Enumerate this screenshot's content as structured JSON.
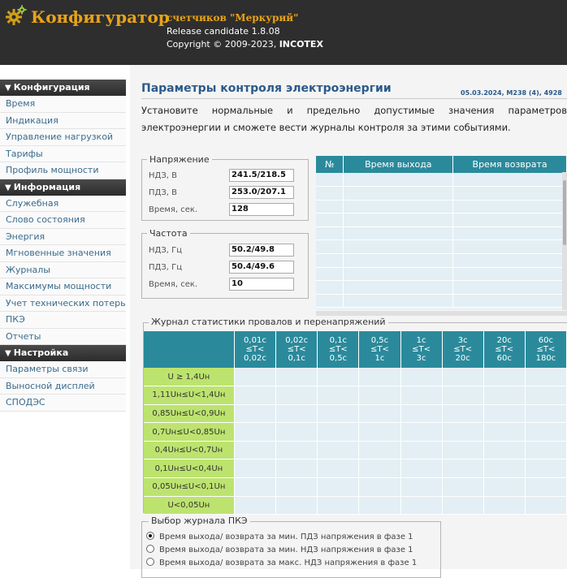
{
  "header": {
    "app_title": "Конфигуратор",
    "app_subtitle": "счетчиков \"Меркурий\"",
    "release": "Release candidate 1.8.08",
    "copyright_prefix": "Copyright © 2009-2023,",
    "copyright_company": "INCOTEX",
    "brand_color": "#e8a317"
  },
  "sidebar": {
    "sections": [
      {
        "title": "Конфигурация",
        "items": [
          "Время",
          "Индикация",
          "Управление нагрузкой",
          "Тарифы",
          "Профиль мощности"
        ]
      },
      {
        "title": "Информация",
        "items": [
          "Служебная",
          "Слово состояния",
          "Энергия",
          "Мгновенные значения",
          "Журналы",
          "Максимумы мощности",
          "Учет технических потерь",
          "ПКЭ",
          "Отчеты"
        ]
      },
      {
        "title": "Настройка",
        "items": [
          "Параметры связи",
          "Выносной дисплей",
          "СПОДЭС"
        ]
      }
    ]
  },
  "page": {
    "title": "Параметры контроля электроэнергии",
    "meta": "05.03.2024, M238 (4), 4928",
    "intro": "Установите нормальные и предельно допустимые значения параметров электроэнергии и сможете вести журналы контроля за этими событиями."
  },
  "voltage": {
    "legend": "Напряжение",
    "rows": [
      {
        "label": "НДЗ, В",
        "value": "241.5/218.5"
      },
      {
        "label": "ПДЗ, В",
        "value": "253.0/207.1"
      },
      {
        "label": "Время, сек.",
        "value": "128"
      }
    ]
  },
  "frequency": {
    "legend": "Частота",
    "rows": [
      {
        "label": "НДЗ, Гц",
        "value": "50.2/49.8"
      },
      {
        "label": "ПДЗ, Гц",
        "value": "50.4/49.6"
      },
      {
        "label": "Время, сек.",
        "value": "10"
      }
    ]
  },
  "events_table": {
    "headers": [
      "№",
      "Время выхода",
      "Время возврата"
    ]
  },
  "journal": {
    "legend": "Журнал статистики провалов и перенапряжений",
    "columns": [
      [
        "0,01с",
        "≤T<",
        "0,02с"
      ],
      [
        "0,02с",
        "≤T<",
        "0,1с"
      ],
      [
        "0,1с",
        "≤T<",
        "0,5с"
      ],
      [
        "0,5с",
        "≤T<",
        "1с"
      ],
      [
        "1с",
        "≤T<",
        "3с"
      ],
      [
        "3с",
        "≤T<",
        "20с"
      ],
      [
        "20с",
        "≤T<",
        "60с"
      ],
      [
        "60с",
        "≤T<",
        "180с"
      ]
    ],
    "rows": [
      "U ≥ 1,4Uн",
      "1,11Uн≤U<1,4Uн",
      "0,85Uн≤U<0,9Uн",
      "0,7Uн≤U<0,85Uн",
      "0,4Uн≤U<0,7Uн",
      "0,1Uн≤U<0,4Uн",
      "0,05Uн≤U<0,1Uн",
      "U<0,05Uн"
    ]
  },
  "pke": {
    "legend": "Выбор журнала ПКЭ",
    "options": [
      {
        "label": "Время выхода/ возврата за мин. ПДЗ напряжения в фазе 1",
        "selected": true
      },
      {
        "label": "Время выхода/ возврата за мин. НДЗ напряжения в фазе 1",
        "selected": false
      },
      {
        "label": "Время выхода/ возврата за макс. НДЗ напряжения в фазе 1",
        "selected": false
      }
    ]
  }
}
